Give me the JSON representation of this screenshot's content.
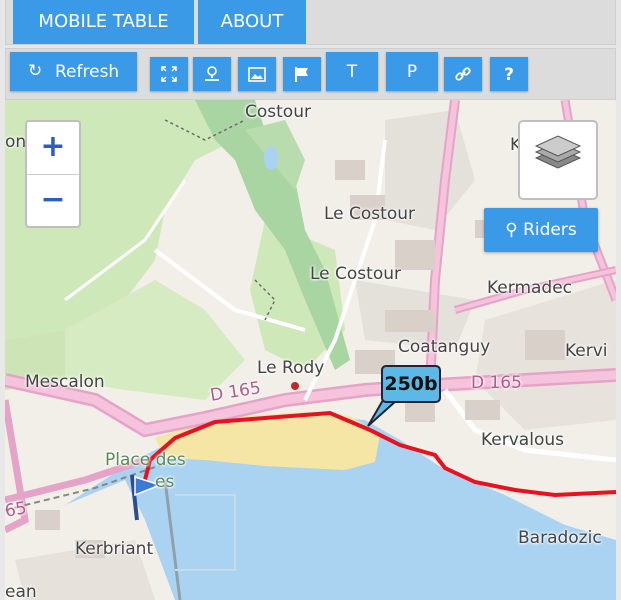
{
  "nav": {
    "tabs": [
      {
        "label": "MOBILE TABLE"
      },
      {
        "label": "ABOUT"
      }
    ]
  },
  "toolbar": {
    "refresh_label": "Refresh",
    "buttons": [
      {
        "icon": "fullscreen-icon"
      },
      {
        "icon": "locate-icon"
      },
      {
        "icon": "image-icon"
      },
      {
        "icon": "flag-icon"
      },
      {
        "label": "T"
      },
      {
        "label": "P"
      },
      {
        "icon": "link-icon"
      },
      {
        "label": "?"
      }
    ]
  },
  "map": {
    "zoom_in": "+",
    "zoom_out": "−",
    "riders_label": "Riders",
    "rider_bib": "250b",
    "places": [
      "Costour",
      "Le Costour",
      "Le Costour",
      "Kermadec",
      "Coatanguy",
      "Kervi",
      "Le Rody",
      "Mescalon",
      "Kervalous",
      "Place des",
      "es",
      "Baradozic",
      "Kerbriant",
      "ean",
      "on",
      "K",
      "65"
    ],
    "roads": [
      "D 165",
      "D 165"
    ],
    "colors": {
      "route": "#e8121e",
      "sea": "#aad3f2",
      "beach": "#f5e6a6",
      "road": "#e6a3c8",
      "forest": "#a5d3a2"
    }
  }
}
